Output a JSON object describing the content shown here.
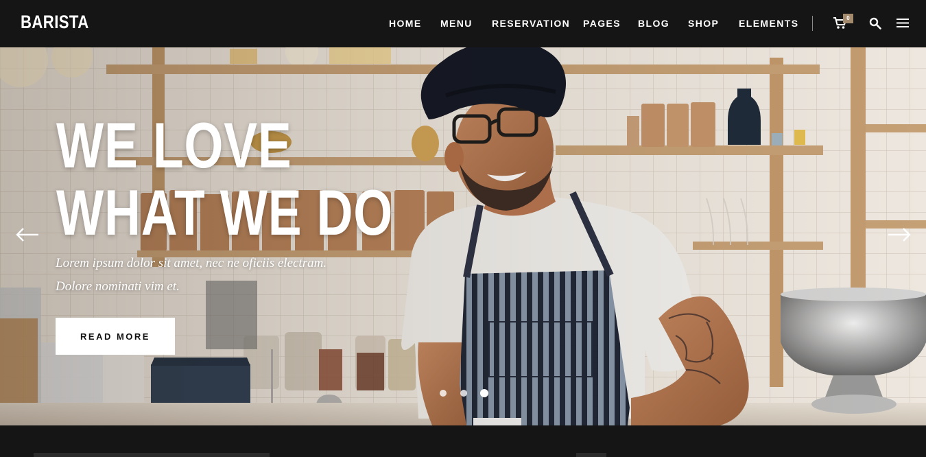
{
  "brand": {
    "logo": "BARISTA"
  },
  "nav": {
    "items": [
      {
        "label": "HOME"
      },
      {
        "label": "MENU"
      },
      {
        "label": "RESERVATION"
      },
      {
        "label": "PAGES"
      },
      {
        "label": "BLOG"
      },
      {
        "label": "SHOP"
      },
      {
        "label": "ELEMENTS"
      }
    ],
    "cart_count": "0",
    "icons": [
      "cart-icon",
      "search-icon",
      "menu-icon"
    ]
  },
  "hero": {
    "title_line1": "WE LOVE",
    "title_line2": "WHAT WE DO",
    "subtitle_line1": "Lorem ipsum dolor sit amet, nec ne oficiis electram.",
    "subtitle_line2": "Dolore nominati vim et.",
    "button_label": "READ MORE",
    "slides_total": 3,
    "active_slide": 3
  },
  "colors": {
    "header_bg": "#151515",
    "accent": "#a38a6d",
    "text_light": "#ffffff"
  }
}
